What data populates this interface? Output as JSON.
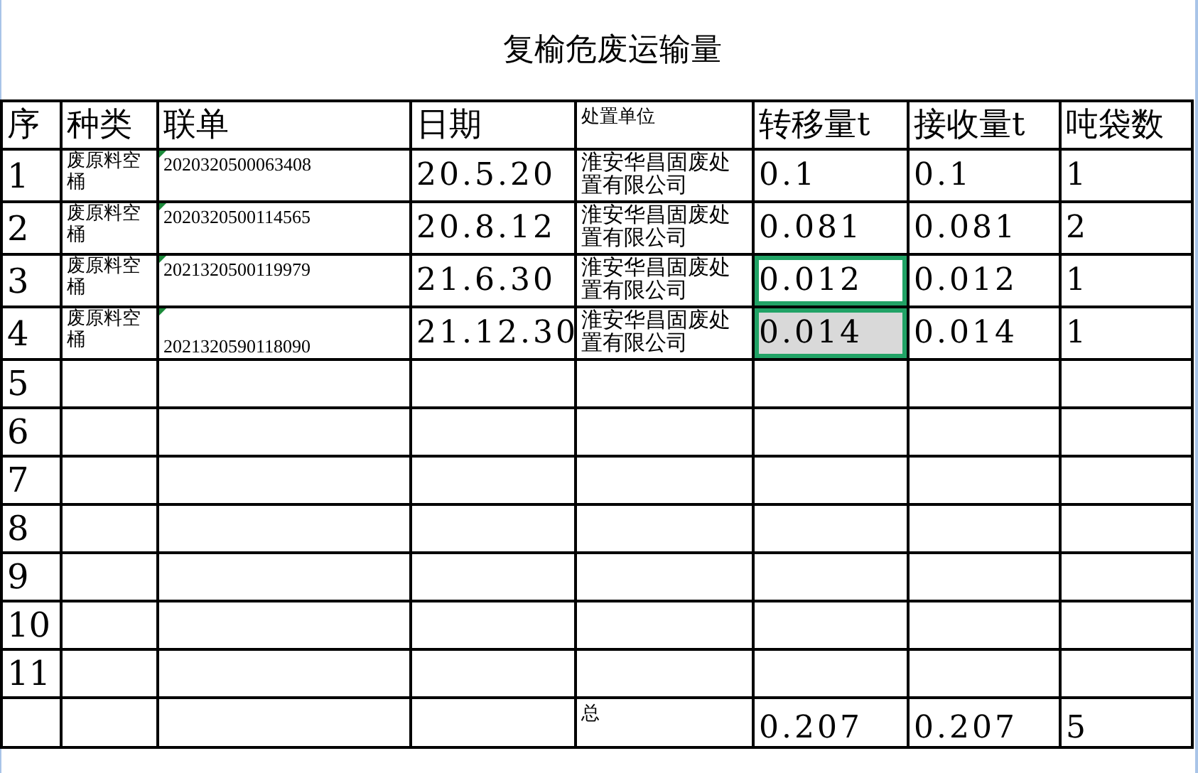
{
  "title": "复榆危废运输量",
  "columns": [
    "序",
    "种类",
    "联单",
    "日期",
    "处置单位",
    "转移量t",
    "接收量t",
    "吨袋数"
  ],
  "rows": [
    {
      "index": "1",
      "kind": "废原料空桶",
      "manifest": "2020320500063408",
      "bottom_aligned": false,
      "flag": true,
      "date": "20.5.20",
      "unit": "淮安华昌固废处置有限公司",
      "transfer": {
        "value": "0.1",
        "selected": false,
        "shaded": false
      },
      "received": "0.1",
      "bags": "1"
    },
    {
      "index": "2",
      "kind": "废原料空桶",
      "manifest": "2020320500114565",
      "bottom_aligned": false,
      "flag": true,
      "date": "20.8.12",
      "unit": "淮安华昌固废处置有限公司",
      "transfer": {
        "value": "0.081",
        "selected": false,
        "shaded": false
      },
      "received": "0.081",
      "bags": "2"
    },
    {
      "index": "3",
      "kind": "废原料空桶",
      "manifest": "2021320500119979",
      "bottom_aligned": false,
      "flag": true,
      "date": "21.6.30",
      "unit": "淮安华昌固废处置有限公司",
      "transfer": {
        "value": "0.012",
        "selected": true,
        "shaded": false
      },
      "received": "0.012",
      "bags": "1"
    },
    {
      "index": "4",
      "kind": "废原料空桶",
      "manifest": "2021320590118090",
      "bottom_aligned": true,
      "flag": true,
      "date": "21.12.30",
      "unit": "淮安华昌固废处置有限公司",
      "transfer": {
        "value": "0.014",
        "selected": true,
        "shaded": true
      },
      "received": "0.014",
      "bags": "1"
    },
    {
      "index": "5"
    },
    {
      "index": "6"
    },
    {
      "index": "7"
    },
    {
      "index": "8"
    },
    {
      "index": "9"
    },
    {
      "index": "10"
    },
    {
      "index": "11"
    }
  ],
  "total": {
    "label": "总",
    "transfer": "0.207",
    "received": "0.207",
    "bags": "5"
  }
}
